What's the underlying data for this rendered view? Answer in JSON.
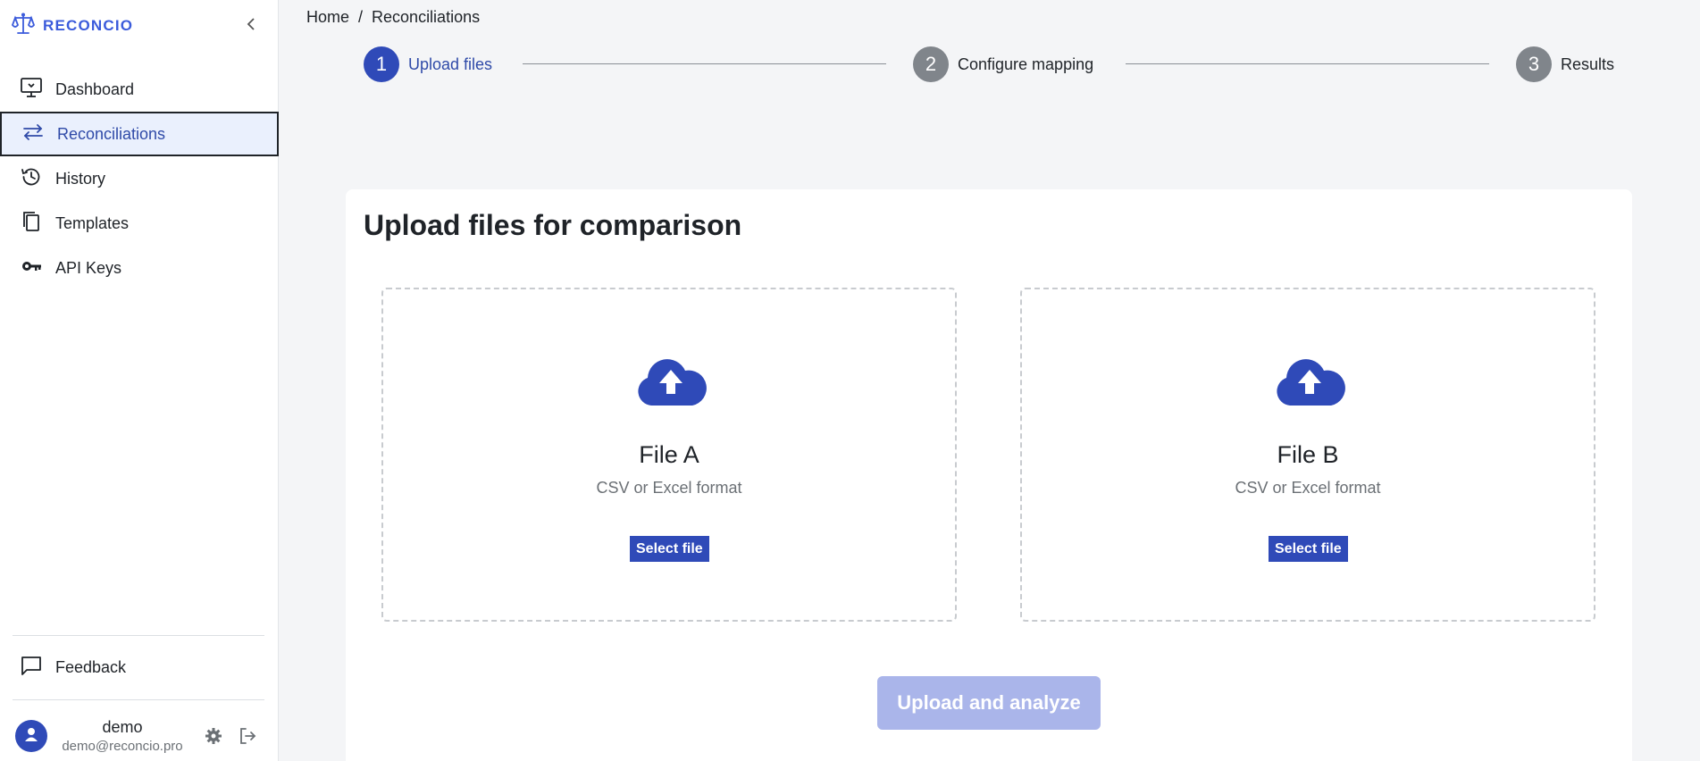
{
  "app": {
    "name": "RECONCIO"
  },
  "sidebar": {
    "items": [
      {
        "label": "Dashboard",
        "icon": "monitor-icon"
      },
      {
        "label": "Reconciliations",
        "icon": "swap-arrows-icon",
        "active": true
      },
      {
        "label": "History",
        "icon": "history-icon"
      },
      {
        "label": "Templates",
        "icon": "copy-icon"
      },
      {
        "label": "API Keys",
        "icon": "key-icon"
      }
    ],
    "feedback_label": "Feedback"
  },
  "user": {
    "name": "demo",
    "email": "demo@reconcio.pro"
  },
  "breadcrumb": {
    "home": "Home",
    "separator": "/",
    "current": "Reconciliations"
  },
  "stepper": [
    {
      "number": "1",
      "label": "Upload files",
      "state": "active"
    },
    {
      "number": "2",
      "label": "Configure mapping",
      "state": "inactive"
    },
    {
      "number": "3",
      "label": "Results",
      "state": "inactive"
    }
  ],
  "main": {
    "title": "Upload files for comparison",
    "file_a": {
      "title": "File A",
      "subtitle": "CSV or Excel format",
      "button": "Select file"
    },
    "file_b": {
      "title": "File B",
      "subtitle": "CSV or Excel format",
      "button": "Select file"
    },
    "submit_label": "Upload and analyze"
  },
  "colors": {
    "accent": "#2f4ab8",
    "brand": "#3b5bdb",
    "active_bg": "#eaf0fd",
    "disabled_button": "#aab5ea"
  }
}
